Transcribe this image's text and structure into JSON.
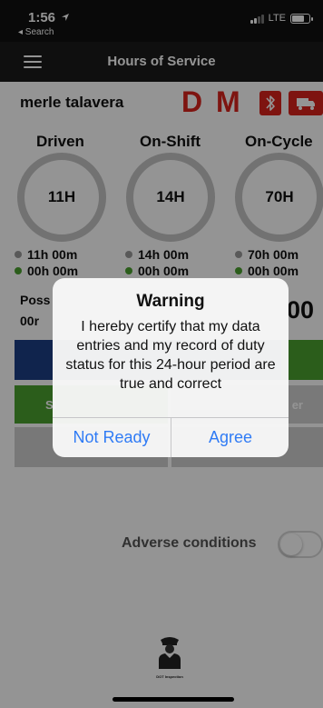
{
  "status_bar": {
    "time": "1:56",
    "back_label": "◂ Search",
    "network": "LTE"
  },
  "nav": {
    "title": "Hours of Service"
  },
  "driver": {
    "name": "merle talavera",
    "badge_d": "D",
    "badge_m": "M"
  },
  "summary": {
    "items": [
      {
        "label": "Driven",
        "dial": "11H",
        "line1": "11h 00m",
        "line2": "00h 00m"
      },
      {
        "label": "On-Shift",
        "dial": "14H",
        "line1": "14h 00m",
        "line2": "00h 00m"
      },
      {
        "label": "On-Cycle",
        "dial": "70H",
        "line1": "70h 00m",
        "line2": "00h 00m"
      }
    ],
    "poss_label": "Poss",
    "poss_value": "00r",
    "right_value": "00"
  },
  "status_buttons": {
    "left_partial": "Sl",
    "right_partial": "er"
  },
  "adverse": {
    "label": "Adverse conditions",
    "enabled": false
  },
  "dot_inspection": {
    "label": "DOT Inspection"
  },
  "alert": {
    "title": "Warning",
    "message": "I hereby certify that my data entries and my record of duty status for this 24-hour period are true and correct",
    "cancel_label": "Not Ready",
    "confirm_label": "Agree"
  },
  "colors": {
    "accent_red": "#d9231d",
    "green": "#4aa12f",
    "blue": "#1d3f86",
    "link_blue": "#2f7bf5"
  },
  "icons": [
    "menu-icon",
    "bluetooth-icon",
    "truck-icon",
    "location-arrow-icon",
    "signal-icon",
    "battery-icon",
    "officer-icon"
  ]
}
